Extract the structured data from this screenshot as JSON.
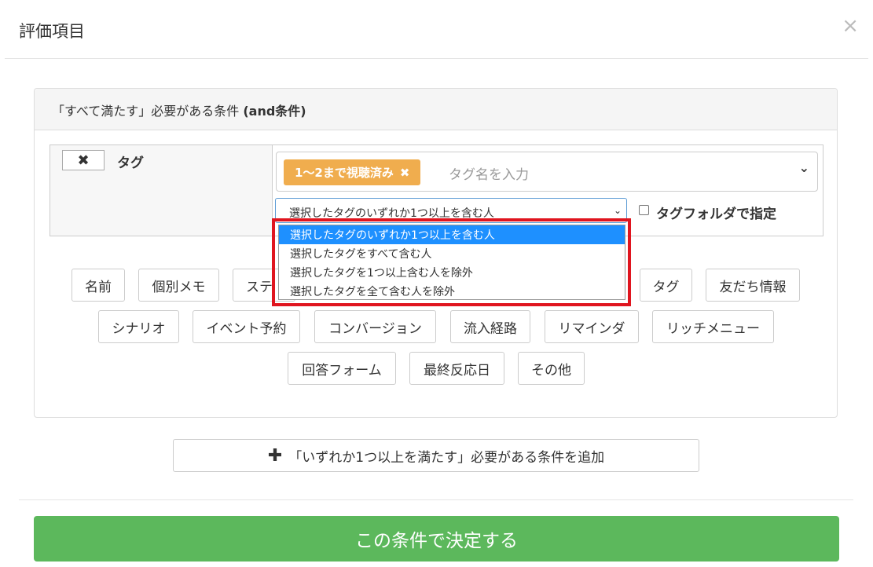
{
  "modal": {
    "title": "評価項目",
    "close_icon": "×"
  },
  "panel": {
    "heading_prefix": "「すべて満たす」必要がある条件",
    "heading_bold": "(and条件)"
  },
  "condition": {
    "remove_icon": "✖",
    "label": "タグ",
    "chip_label": "1〜2まで視聴済み",
    "chip_remove_icon": "✖",
    "tag_placeholder": "タグ名を入力",
    "chevron_icon": "⌄",
    "select_value": "選択したタグのいずれか1つ以上を含む人",
    "select_arrow": "⌄",
    "folder_label": "タグフォルダで指定"
  },
  "dropdown": {
    "options": [
      "選択したタグのいずれか1つ以上を含む人",
      "選択したタグをすべて含む人",
      "選択したタグを1つ以上含む人を除外",
      "選択したタグを全て含む人を除外"
    ],
    "selected_index": 0
  },
  "categories": {
    "row1": [
      "名前",
      "個別メモ",
      "ステ",
      "タグ",
      "友だち情報"
    ],
    "row2": [
      "シナリオ",
      "イベント予約",
      "コンバージョン",
      "流入経路",
      "リマインダ",
      "リッチメニュー"
    ],
    "row3": [
      "回答フォーム",
      "最終反応日",
      "その他"
    ]
  },
  "add_condition": {
    "icon": "✚",
    "label": "「いずれか1つ以上を満たす」必要がある条件を追加"
  },
  "submit": {
    "label": "この条件で決定する"
  },
  "colors": {
    "tag_chip": "#f0ad4e",
    "submit": "#5cb85c",
    "dropdown_selected": "#1e90ff",
    "highlight": "#e0151f"
  }
}
